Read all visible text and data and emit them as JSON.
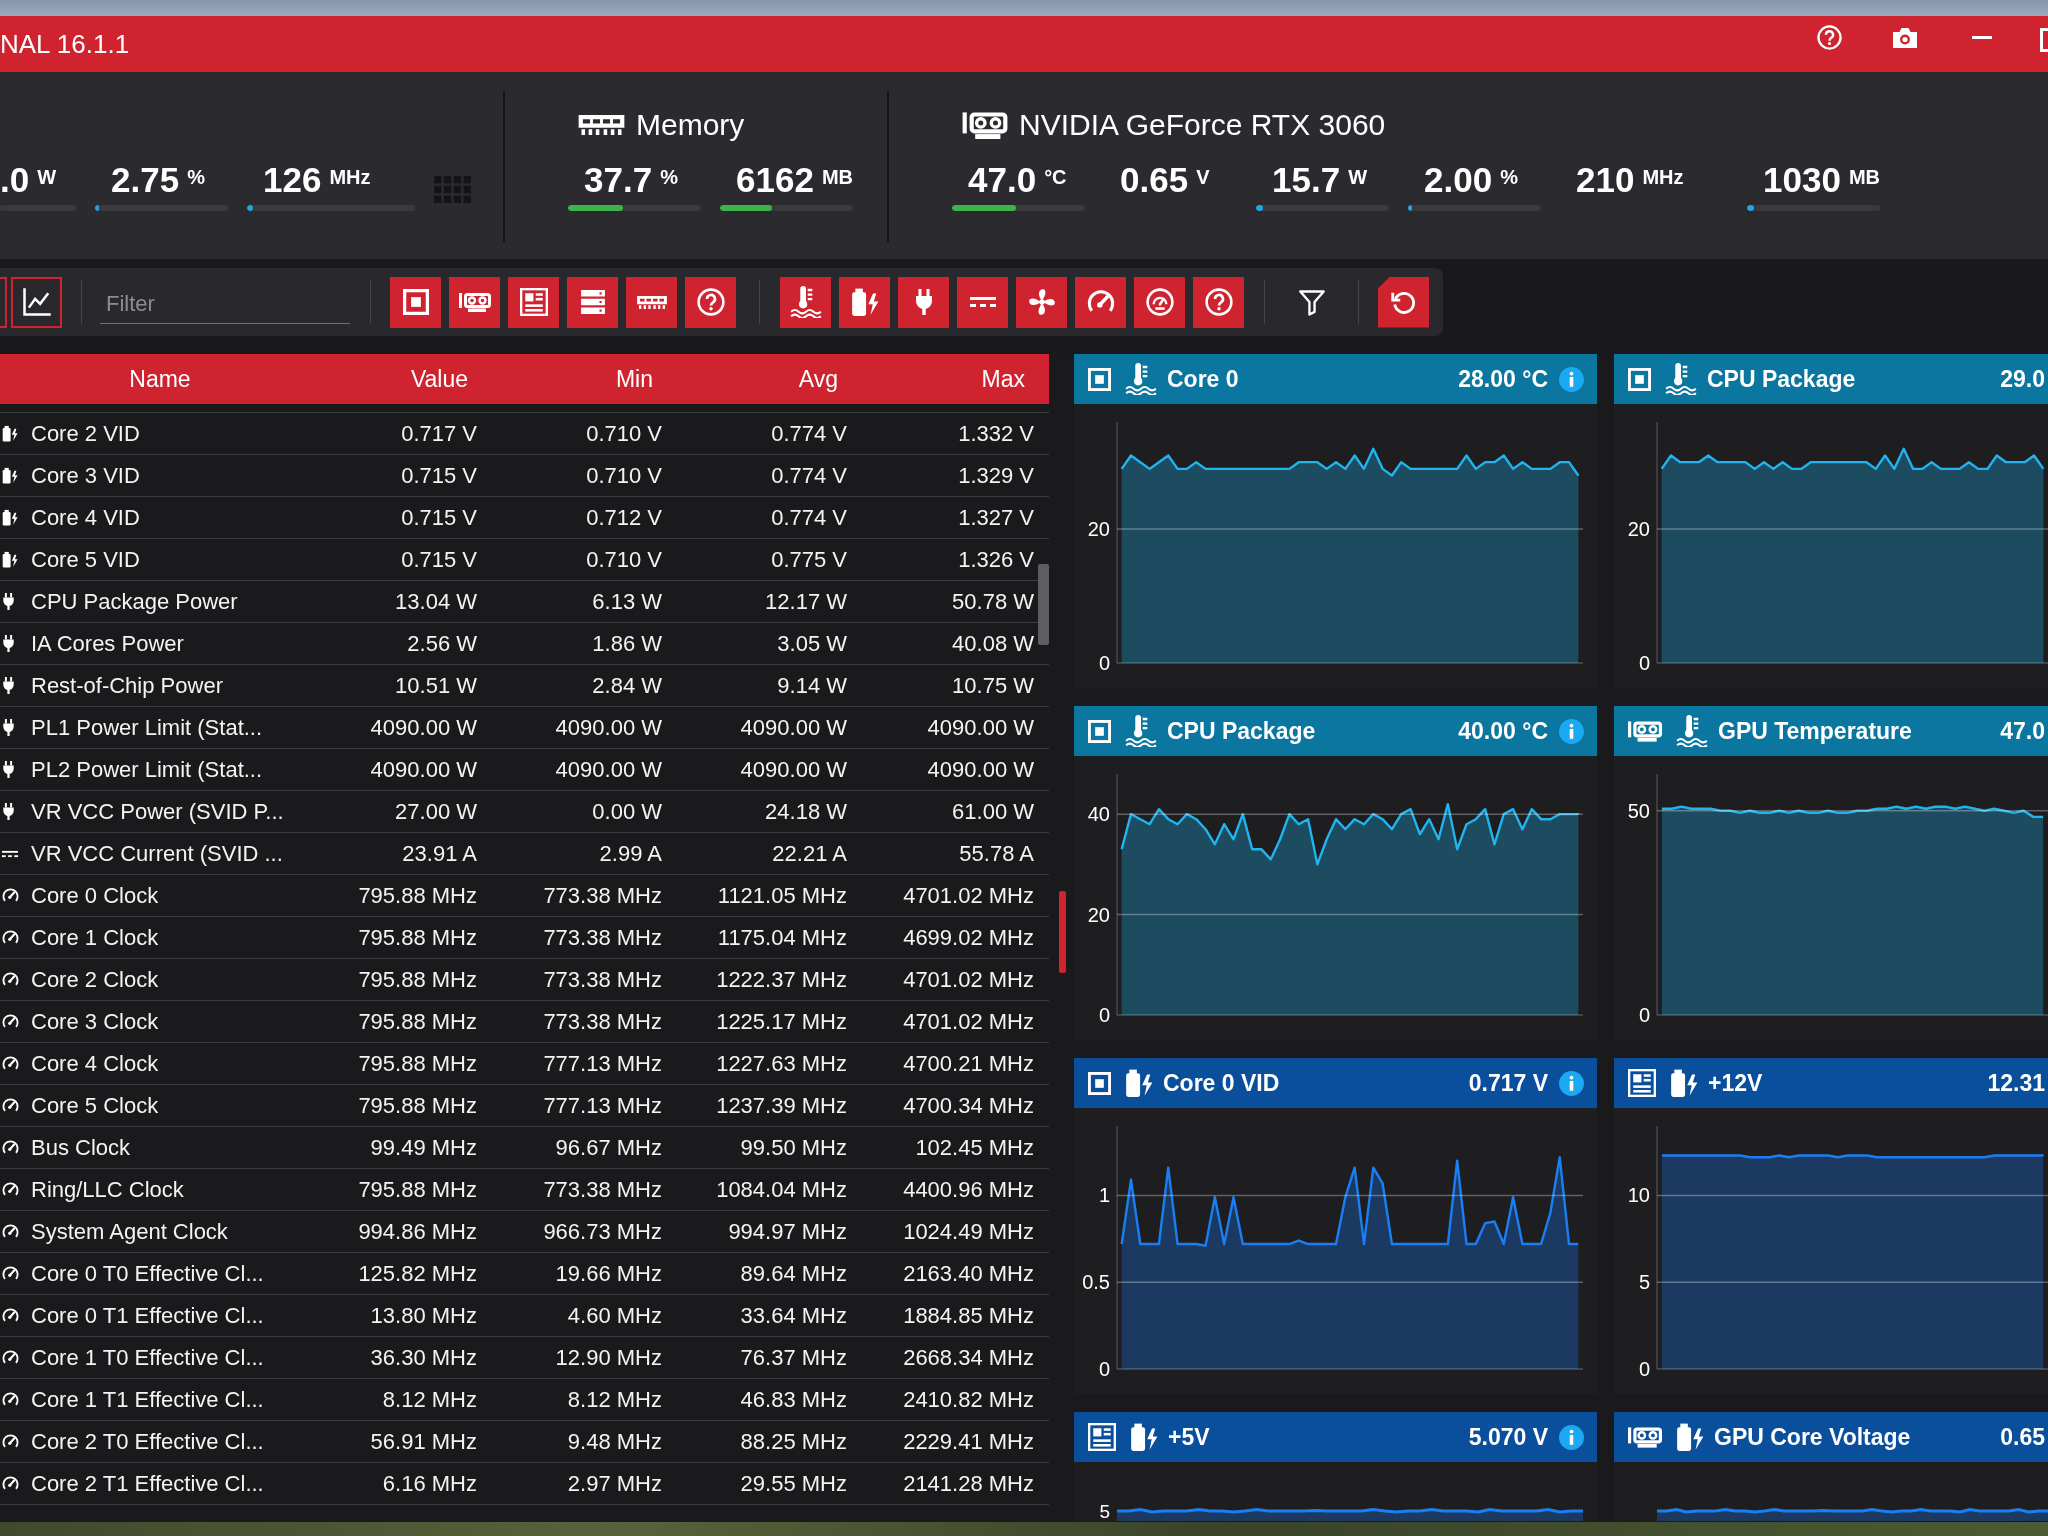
{
  "window": {
    "title": "NAL 16.1.1"
  },
  "summary": {
    "groups": [
      {
        "kind": "cpu",
        "readings": [
          {
            "value": ".0",
            "unit": "W",
            "level": 0
          },
          {
            "value": "2.75",
            "unit": "%",
            "level": 0.03,
            "color": "#1ea7e4"
          },
          {
            "value": "126",
            "unit": "MHz",
            "level": 0.035,
            "color": "#1ea7e4"
          }
        ]
      },
      {
        "kind": "memory",
        "title": "Memory",
        "readings": [
          {
            "value": "37.7",
            "unit": "%",
            "level": 0.41,
            "color": "#3bb54a"
          },
          {
            "value": "6162",
            "unit": "MB",
            "level": 0.39,
            "color": "#3bb54a"
          }
        ]
      },
      {
        "kind": "gpu",
        "title": "NVIDIA GeForce RTX 3060",
        "readings": [
          {
            "value": "47.0",
            "unit": "°C",
            "level": 0.48,
            "color": "#3bb54a"
          },
          {
            "value": "0.65",
            "unit": "V"
          },
          {
            "value": "15.7",
            "unit": "W",
            "level": 0.05,
            "color": "#1ea7e4"
          },
          {
            "value": "2.00",
            "unit": "%",
            "level": 0.03,
            "color": "#1ea7e4"
          },
          {
            "value": "210",
            "unit": "MHz"
          },
          {
            "value": "1030",
            "unit": "MB",
            "level": 0.05,
            "color": "#1ea7e4"
          }
        ]
      }
    ]
  },
  "toolbar": {
    "filter": {
      "placeholder": "Filter"
    },
    "device_filters": [
      {
        "kind": "cpu",
        "on": true
      },
      {
        "kind": "gpu",
        "on": true
      },
      {
        "kind": "motherboard",
        "on": true
      },
      {
        "kind": "storage",
        "on": true
      },
      {
        "kind": "memory",
        "on": true
      },
      {
        "kind": "other",
        "on": true
      }
    ],
    "sensor_filters": [
      {
        "kind": "temperature",
        "on": true
      },
      {
        "kind": "voltage",
        "on": true
      },
      {
        "kind": "power",
        "on": true
      },
      {
        "kind": "current",
        "on": true
      },
      {
        "kind": "fan",
        "on": true
      },
      {
        "kind": "clock",
        "on": true
      },
      {
        "kind": "usage",
        "on": true
      },
      {
        "kind": "other",
        "on": true
      }
    ]
  },
  "table": {
    "columns": [
      "Name",
      "Value",
      "Min",
      "Avg",
      "Max"
    ],
    "rows": [
      {
        "kind": "voltage",
        "name": "Core 2 VID",
        "value": "0.717 V",
        "min": "0.710 V",
        "avg": "0.774 V",
        "max": "1.332 V"
      },
      {
        "kind": "voltage",
        "name": "Core 3 VID",
        "value": "0.715 V",
        "min": "0.710 V",
        "avg": "0.774 V",
        "max": "1.329 V"
      },
      {
        "kind": "voltage",
        "name": "Core 4 VID",
        "value": "0.715 V",
        "min": "0.712 V",
        "avg": "0.774 V",
        "max": "1.327 V"
      },
      {
        "kind": "voltage",
        "name": "Core 5 VID",
        "value": "0.715 V",
        "min": "0.710 V",
        "avg": "0.775 V",
        "max": "1.326 V"
      },
      {
        "kind": "power",
        "name": "CPU Package Power",
        "value": "13.04 W",
        "min": "6.13 W",
        "avg": "12.17 W",
        "max": "50.78 W"
      },
      {
        "kind": "power",
        "name": "IA Cores Power",
        "value": "2.56 W",
        "min": "1.86 W",
        "avg": "3.05 W",
        "max": "40.08 W"
      },
      {
        "kind": "power",
        "name": "Rest-of-Chip Power",
        "value": "10.51 W",
        "min": "2.84 W",
        "avg": "9.14 W",
        "max": "10.75 W"
      },
      {
        "kind": "power",
        "name": "PL1 Power Limit (Stat...",
        "value": "4090.00 W",
        "min": "4090.00 W",
        "avg": "4090.00 W",
        "max": "4090.00 W"
      },
      {
        "kind": "power",
        "name": "PL2 Power Limit (Stat...",
        "value": "4090.00 W",
        "min": "4090.00 W",
        "avg": "4090.00 W",
        "max": "4090.00 W"
      },
      {
        "kind": "power",
        "name": "VR VCC Power (SVID P...",
        "value": "27.00 W",
        "min": "0.00 W",
        "avg": "24.18 W",
        "max": "61.00 W"
      },
      {
        "kind": "current",
        "name": "VR VCC Current (SVID ...",
        "value": "23.91 A",
        "min": "2.99 A",
        "avg": "22.21 A",
        "max": "55.78 A"
      },
      {
        "kind": "clock",
        "name": "Core 0 Clock",
        "value": "795.88 MHz",
        "min": "773.38 MHz",
        "avg": "1121.05 MHz",
        "max": "4701.02 MHz"
      },
      {
        "kind": "clock",
        "name": "Core 1 Clock",
        "value": "795.88 MHz",
        "min": "773.38 MHz",
        "avg": "1175.04 MHz",
        "max": "4699.02 MHz"
      },
      {
        "kind": "clock",
        "name": "Core 2 Clock",
        "value": "795.88 MHz",
        "min": "773.38 MHz",
        "avg": "1222.37 MHz",
        "max": "4701.02 MHz"
      },
      {
        "kind": "clock",
        "name": "Core 3 Clock",
        "value": "795.88 MHz",
        "min": "773.38 MHz",
        "avg": "1225.17 MHz",
        "max": "4701.02 MHz"
      },
      {
        "kind": "clock",
        "name": "Core 4 Clock",
        "value": "795.88 MHz",
        "min": "777.13 MHz",
        "avg": "1227.63 MHz",
        "max": "4700.21 MHz"
      },
      {
        "kind": "clock",
        "name": "Core 5 Clock",
        "value": "795.88 MHz",
        "min": "777.13 MHz",
        "avg": "1237.39 MHz",
        "max": "4700.34 MHz"
      },
      {
        "kind": "clock",
        "name": "Bus Clock",
        "value": "99.49 MHz",
        "min": "96.67 MHz",
        "avg": "99.50 MHz",
        "max": "102.45 MHz"
      },
      {
        "kind": "clock",
        "name": "Ring/LLC Clock",
        "value": "795.88 MHz",
        "min": "773.38 MHz",
        "avg": "1084.04 MHz",
        "max": "4400.96 MHz"
      },
      {
        "kind": "clock",
        "name": "System Agent Clock",
        "value": "994.86 MHz",
        "min": "966.73 MHz",
        "avg": "994.97 MHz",
        "max": "1024.49 MHz"
      },
      {
        "kind": "clock",
        "name": "Core 0 T0 Effective Cl...",
        "value": "125.82 MHz",
        "min": "19.66 MHz",
        "avg": "89.64 MHz",
        "max": "2163.40 MHz"
      },
      {
        "kind": "clock",
        "name": "Core 0 T1 Effective Cl...",
        "value": "13.80 MHz",
        "min": "4.60 MHz",
        "avg": "33.64 MHz",
        "max": "1884.85 MHz"
      },
      {
        "kind": "clock",
        "name": "Core 1 T0 Effective Cl...",
        "value": "36.30 MHz",
        "min": "12.90 MHz",
        "avg": "76.37 MHz",
        "max": "2668.34 MHz"
      },
      {
        "kind": "clock",
        "name": "Core 1 T1 Effective Cl...",
        "value": "8.12 MHz",
        "min": "8.12 MHz",
        "avg": "46.83 MHz",
        "max": "2410.82 MHz"
      },
      {
        "kind": "clock",
        "name": "Core 2 T0 Effective Cl...",
        "value": "56.91 MHz",
        "min": "9.48 MHz",
        "avg": "88.25 MHz",
        "max": "2229.41 MHz"
      },
      {
        "kind": "clock",
        "name": "Core 2 T1 Effective Cl...",
        "value": "6.16 MHz",
        "min": "2.97 MHz",
        "avg": "29.55 MHz",
        "max": "2141.28 MHz"
      }
    ]
  },
  "panels": [
    {
      "kind": "cpu_temperature",
      "name": "Core 0",
      "value": "28.00 °C",
      "info": true,
      "chart_data": {
        "type": "area",
        "ylim": [
          0,
          36
        ],
        "yticks": [
          0,
          20
        ],
        "grid": true,
        "color": "#1fb5f0",
        "values": [
          29,
          31,
          30,
          29,
          30,
          31,
          29,
          29,
          30,
          29,
          29,
          29,
          29,
          29,
          29,
          29,
          29,
          29,
          29,
          30,
          30,
          30,
          29,
          30,
          29,
          31,
          29,
          32,
          29,
          28,
          30,
          29,
          29,
          29,
          29,
          29,
          29,
          31,
          29,
          30,
          30,
          31,
          29,
          30,
          29,
          29,
          29,
          30,
          30,
          28
        ]
      }
    },
    {
      "kind": "cpu_temperature",
      "name": "CPU Package",
      "value": "29.0",
      "info": false,
      "chart_data": {
        "type": "area",
        "ylim": [
          0,
          36
        ],
        "yticks": [
          0,
          20
        ],
        "grid": true,
        "color": "#1fb5f0",
        "values": [
          29,
          31,
          30,
          30,
          30,
          31,
          30,
          30,
          30,
          30,
          29,
          30,
          29,
          30,
          29,
          29,
          30,
          30,
          30,
          30,
          30,
          30,
          30,
          29,
          31,
          29,
          32,
          29,
          29,
          30,
          29,
          29,
          29,
          30,
          29,
          29,
          31,
          30,
          30,
          30,
          31,
          29
        ]
      }
    },
    {
      "kind": "cpu_temperature",
      "name": "CPU Package",
      "value": "40.00 °C",
      "info": true,
      "chart_data": {
        "type": "area",
        "ylim": [
          0,
          48
        ],
        "yticks": [
          0,
          20,
          40
        ],
        "grid": true,
        "color": "#1fb5f0",
        "values": [
          33,
          40,
          39,
          38,
          41,
          39,
          38,
          40,
          39,
          37,
          34,
          38,
          35,
          40,
          33,
          33,
          31,
          35,
          40,
          38,
          39,
          30,
          35,
          39,
          37,
          39,
          38,
          40,
          39,
          37,
          40,
          41,
          36,
          39,
          35,
          42,
          33,
          38,
          39,
          41,
          34,
          40,
          41,
          37,
          41,
          39,
          39,
          40,
          40,
          40
        ]
      }
    },
    {
      "kind": "gpu_temperature",
      "name": "GPU Temperature",
      "value": "47.0",
      "info": false,
      "chart_data": {
        "type": "area",
        "ylim": [
          0,
          59
        ],
        "yticks": [
          0,
          50
        ],
        "grid": true,
        "color": "#1fb5f0",
        "values": [
          50.5,
          50.5,
          51,
          50.5,
          50.5,
          50.5,
          50,
          50,
          49.5,
          50,
          49.5,
          49.5,
          50,
          49.5,
          50,
          49.5,
          49.5,
          50,
          49.5,
          49.5,
          50,
          50,
          50.5,
          50.5,
          51,
          50.5,
          51,
          50.5,
          51,
          51,
          50.5,
          51,
          50.5,
          50,
          50.5,
          50,
          49.5,
          50,
          48.5,
          48.5
        ]
      }
    },
    {
      "kind": "cpu_voltage",
      "name": "Core 0 VID",
      "value": "0.717 V",
      "info": true,
      "chart_data": {
        "type": "area",
        "ylim": [
          0,
          1.4
        ],
        "yticks": [
          0,
          0.5,
          1
        ],
        "grid": true,
        "color": "#1a7ff5",
        "values": [
          0.72,
          1.09,
          0.72,
          0.72,
          0.72,
          1.16,
          0.72,
          0.72,
          0.72,
          0.71,
          0.99,
          0.72,
          0.99,
          0.72,
          0.72,
          0.72,
          0.72,
          0.72,
          0.72,
          0.74,
          0.72,
          0.72,
          0.72,
          0.72,
          0.99,
          1.16,
          0.72,
          1.16,
          1.07,
          0.72,
          0.72,
          0.72,
          0.72,
          0.72,
          0.72,
          0.72,
          1.2,
          0.72,
          0.72,
          0.84,
          0.85,
          0.72,
          0.99,
          0.72,
          0.72,
          0.72,
          0.9,
          1.22,
          0.72,
          0.72
        ]
      }
    },
    {
      "kind": "motherboard_voltage",
      "name": "+12V",
      "value": "12.31",
      "info": false,
      "chart_data": {
        "type": "area",
        "ylim": [
          0,
          14
        ],
        "yticks": [
          0,
          5,
          10
        ],
        "grid": true,
        "color": "#1a7ff5",
        "values": [
          12.3,
          12.3,
          12.3,
          12.3,
          12.3,
          12.3,
          12.3,
          12.3,
          12.3,
          12.2,
          12.2,
          12.2,
          12.3,
          12.2,
          12.3,
          12.3,
          12.3,
          12.3,
          12.2,
          12.3,
          12.3,
          12.3,
          12.2,
          12.2,
          12.2,
          12.2,
          12.2,
          12.2,
          12.2,
          12.2,
          12.2,
          12.2,
          12.2,
          12.2,
          12.3,
          12.3,
          12.3,
          12.3,
          12.3,
          12.3
        ]
      }
    },
    {
      "kind": "motherboard_voltage",
      "name": "+5V",
      "value": "5.070 V",
      "info": true,
      "tick_label": "5"
    },
    {
      "kind": "gpu_voltage",
      "name": "GPU Core Voltage",
      "value": "0.65",
      "info": false
    }
  ]
}
